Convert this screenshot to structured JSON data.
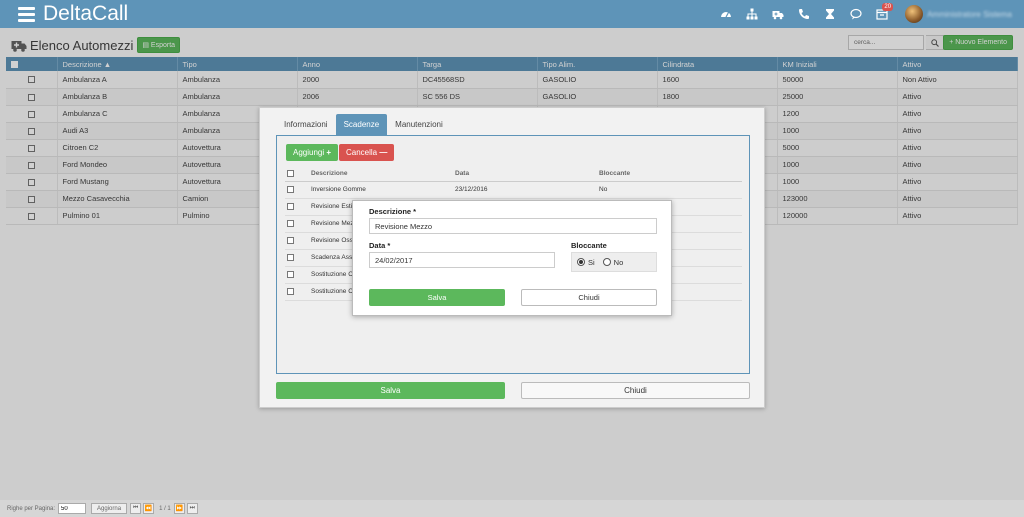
{
  "app": {
    "brand": "DeltaCall"
  },
  "header": {
    "notifications_count": "20",
    "user_name": "Amministratore Sistema",
    "icons": [
      "dashboard-icon",
      "sitemap-icon",
      "ambulance-icon",
      "phone-icon",
      "hourglass-icon",
      "chat-icon",
      "calendar-icon"
    ]
  },
  "page": {
    "title": "Elenco Automezzi",
    "export_label": "Esporta",
    "search_placeholder": "cerca...",
    "new_button": "Nuovo Elemento"
  },
  "grid": {
    "columns": [
      "Descrizione ▲",
      "Tipo",
      "Anno",
      "Targa",
      "Tipo Alim.",
      "Cilindrata",
      "KM Iniziali",
      "Attivo"
    ],
    "rows": [
      [
        "Ambulanza A",
        "Ambulanza",
        "2000",
        "DC45568SD",
        "GASOLIO",
        "1600",
        "50000",
        "Non Attivo"
      ],
      [
        "Ambulanza B",
        "Ambulanza",
        "2006",
        "SC 556 DS",
        "GASOLIO",
        "1800",
        "25000",
        "Attivo"
      ],
      [
        "Ambulanza C",
        "Ambulanza",
        "",
        "",
        "",
        "",
        "1200",
        "Attivo"
      ],
      [
        "Audi A3",
        "Ambulanza",
        "",
        "",
        "",
        "",
        "1000",
        "Attivo"
      ],
      [
        "Citroen C2",
        "Autovettura",
        "",
        "",
        "",
        "",
        "5000",
        "Attivo"
      ],
      [
        "Ford Mondeo",
        "Autovettura",
        "",
        "",
        "",
        "",
        "1000",
        "Attivo"
      ],
      [
        "Ford Mustang",
        "Autovettura",
        "",
        "",
        "",
        "",
        "1000",
        "Attivo"
      ],
      [
        "Mezzo Casavecchia",
        "Camion",
        "",
        "",
        "",
        "",
        "123000",
        "Attivo"
      ],
      [
        "Pulmino 01",
        "Pulmino",
        "",
        "",
        "",
        "",
        "120000",
        "Attivo"
      ]
    ]
  },
  "footer": {
    "rows_per_page_label": "Righe per Pagina:",
    "rows_per_page_value": "50",
    "refresh_label": "Aggiorna",
    "page_info": "1 / 1"
  },
  "modal": {
    "tabs": [
      "Informazioni",
      "Scadenze",
      "Manutenzioni"
    ],
    "active_tab": "Scadenze",
    "add_label": "Aggiungi",
    "delete_label": "Cancella",
    "sub_columns": [
      "Descrizione",
      "Data",
      "Bloccante"
    ],
    "sub_rows": [
      [
        "Inversione Gomme",
        "23/12/2016",
        "No"
      ],
      [
        "Revisione Esti",
        "",
        ""
      ],
      [
        "Revisione Mez",
        "",
        ""
      ],
      [
        "Revisione Oss",
        "",
        ""
      ],
      [
        "Scadenza Ass",
        "",
        ""
      ],
      [
        "Sostituzione C",
        "",
        ""
      ],
      [
        "Sostituzione C",
        "",
        ""
      ]
    ],
    "save_label": "Salva",
    "close_label": "Chiudi"
  },
  "dialog": {
    "description_label": "Descrizione *",
    "description_value": "Revisione Mezzo",
    "date_label": "Data *",
    "date_value": "24/02/2017",
    "blocking_label": "Bloccante",
    "yes_label": "Si",
    "no_label": "No",
    "selected": "Si",
    "save_label": "Salva",
    "close_label": "Chiudi"
  },
  "colors": {
    "primary": "#5e94b8",
    "success": "#5cb85c",
    "danger": "#d9534f"
  }
}
